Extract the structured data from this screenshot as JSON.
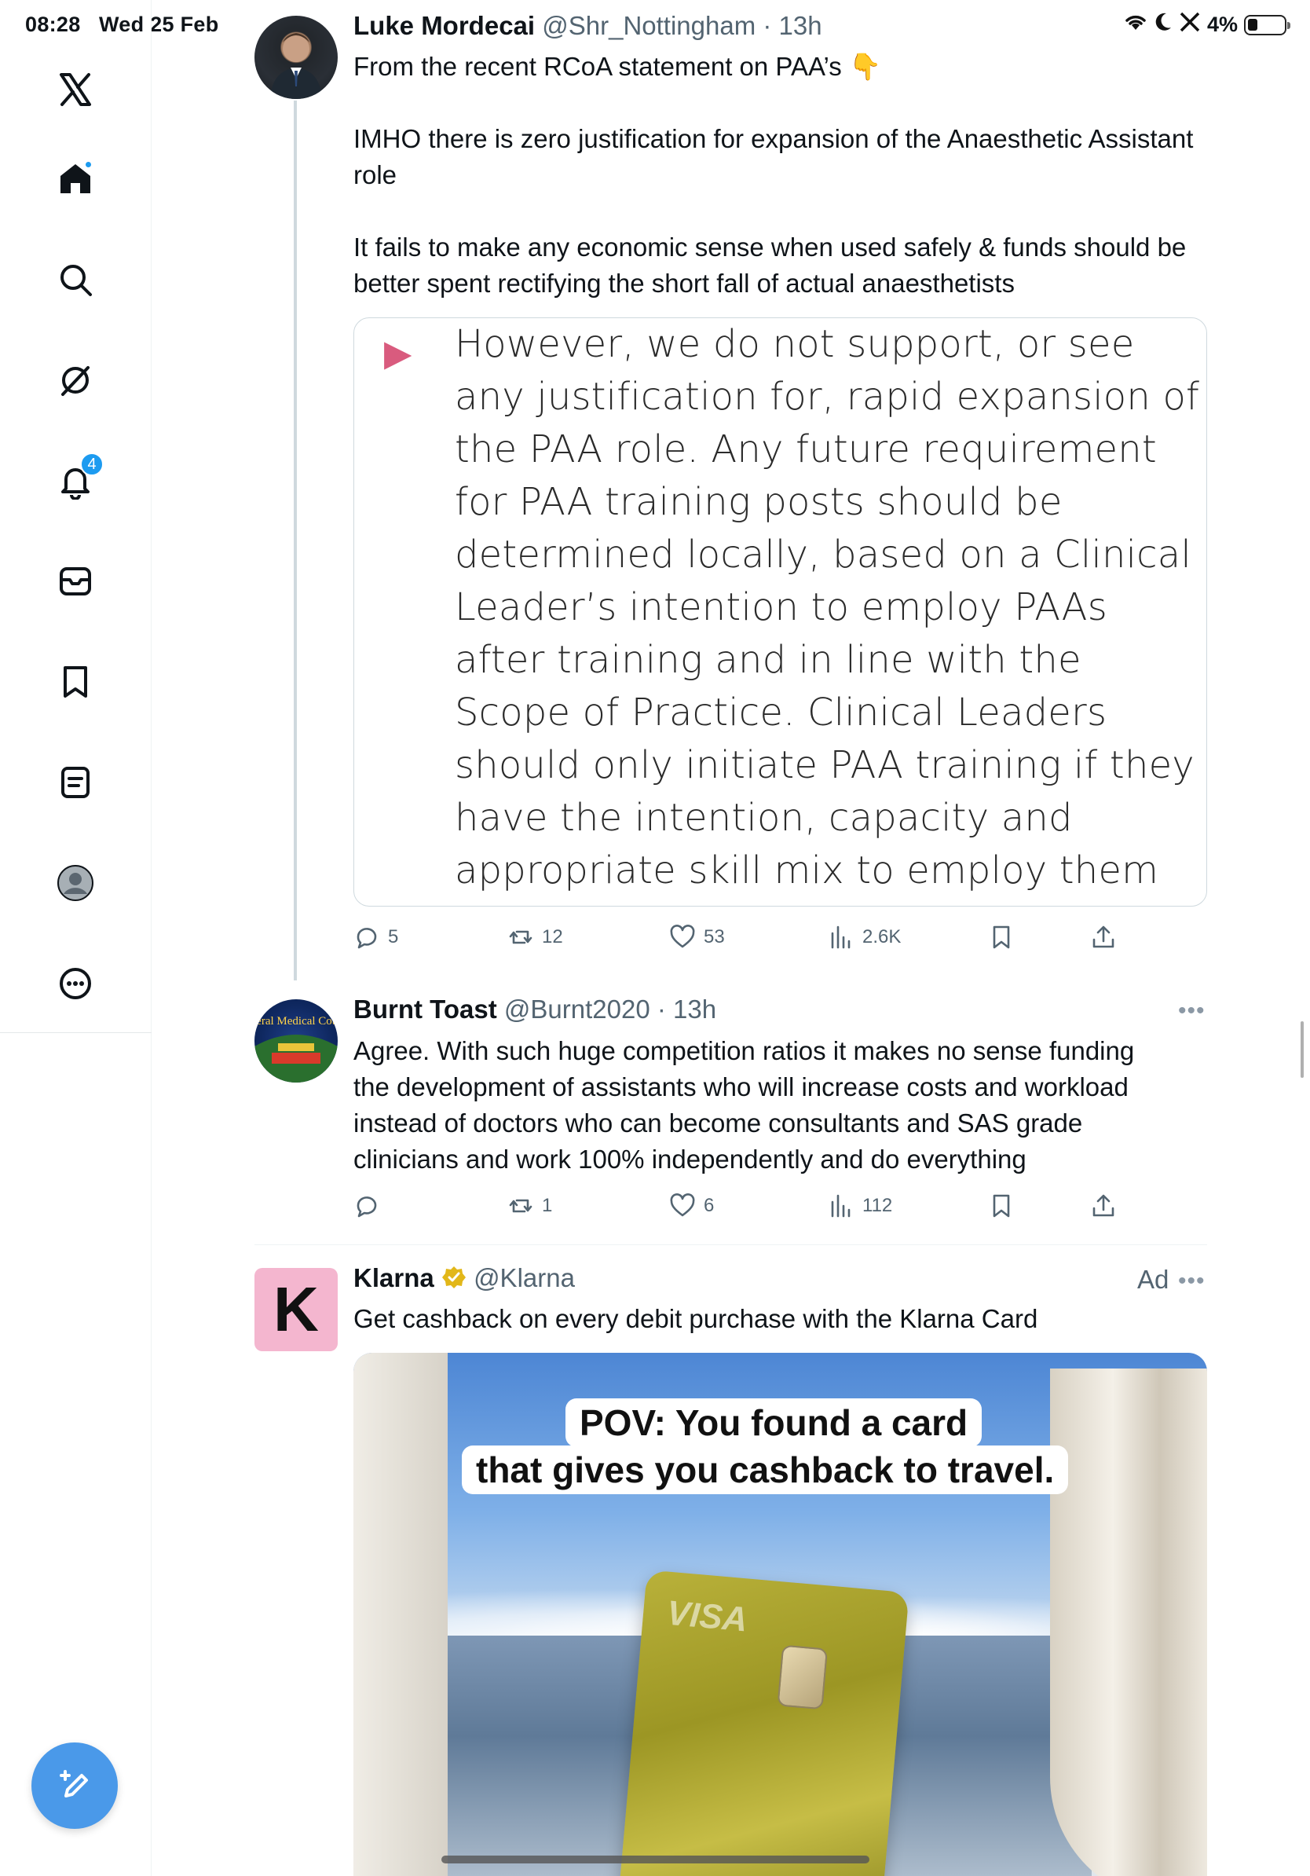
{
  "status_bar": {
    "time": "08:28",
    "date": "Wed 25 Feb",
    "battery": "4%"
  },
  "sidebar": {
    "notification_count": "4",
    "items": [
      {
        "name": "x-logo"
      },
      {
        "name": "home"
      },
      {
        "name": "search"
      },
      {
        "name": "grok"
      },
      {
        "name": "notifications"
      },
      {
        "name": "messages"
      },
      {
        "name": "bookmarks"
      },
      {
        "name": "lists"
      },
      {
        "name": "profile"
      },
      {
        "name": "more"
      }
    ]
  },
  "tweets": [
    {
      "name": "Luke Mordecai",
      "handle": "@Shr_Nottingham",
      "time": "13h",
      "text_1": "From the recent RCoA statement on PAA’s 👇",
      "text_2": "IMHO there is zero justification for expansion of the Anaesthetic Assistant role",
      "text_3": "It fails to make any economic sense when used safely & funds should be better spent rectifying the short fall of actual anaesthetists",
      "quote": "However, we do not support, or see any justification for, rapid expansion of the PAA role. Any future requirement for PAA training posts should be determined locally, based on a Clinical Leader’s intention to employ PAAs after training and in line with the Scope of Practice. Clinical Leaders should only initiate PAA training if they have the intention, capacity and appropriate skill mix to employ them once they qualify.",
      "replies": "5",
      "reposts": "12",
      "likes": "53",
      "views": "2.6K"
    },
    {
      "name": "Burnt Toast",
      "handle": "@Burnt2020",
      "time": "13h",
      "text": "Agree. With such huge competition ratios it makes no sense funding the development of assistants who will increase costs and workload instead of doctors who can become consultants and SAS grade clinicians and work 100% independently and do everything",
      "avatar_text": "General Medical Council",
      "replies": "",
      "reposts": "1",
      "likes": "6",
      "views": "112"
    },
    {
      "name": "Klarna",
      "handle": "@Klarna",
      "ad_label": "Ad",
      "avatar_letter": "K",
      "text": "Get cashback on every debit purchase with the Klarna Card",
      "caption_1": "POV: You found a card",
      "caption_2": "that gives you cashback to travel.",
      "card_brand": "VISA"
    }
  ],
  "colors": {
    "accent": "#1d9bf0",
    "compose": "#4a99e9",
    "klarna_pink": "#f4b6cf",
    "verified_gold": "#e2b719",
    "quote_bullet": "#d95b7e"
  }
}
